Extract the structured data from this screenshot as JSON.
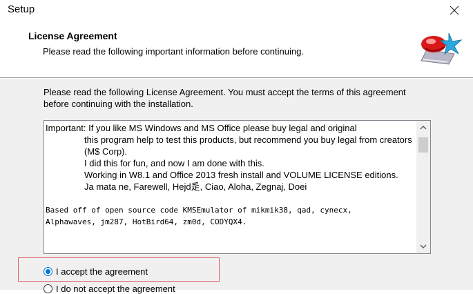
{
  "window": {
    "title": "Setup",
    "close_icon": "close-icon"
  },
  "header": {
    "title": "License Agreement",
    "subtitle": "Please read the following important information before continuing."
  },
  "intro": "Please read the following License Agreement. You must accept the terms of this agreement before continuing with the installation.",
  "license": {
    "lines": [
      "Important: If you like MS Windows and MS Office please buy legal and original",
      "this program help to test this products, but recommend you buy legal from creators (M$ Corp).",
      "I did this for fun, and now I am done with this.",
      "Working in W8.1 and Office 2013 fresh install and VOLUME LICENSE editions.",
      "Ja mata ne, Farewell, Hejd辵, Ciao, Aloha, Zegnaj, Doei",
      "Based off of open source code KMSEmulator of mikmik38, qad, cynecx,",
      "Alphawaves, jm287, HotBird64, zm0d, CODYQX4."
    ]
  },
  "options": {
    "accept": {
      "label": "I accept the agreement",
      "checked": true
    },
    "decline": {
      "label": "I do not accept the agreement",
      "checked": false
    }
  },
  "colors": {
    "selection_highlight": "#e06060",
    "radio_accent": "#0078d7"
  }
}
